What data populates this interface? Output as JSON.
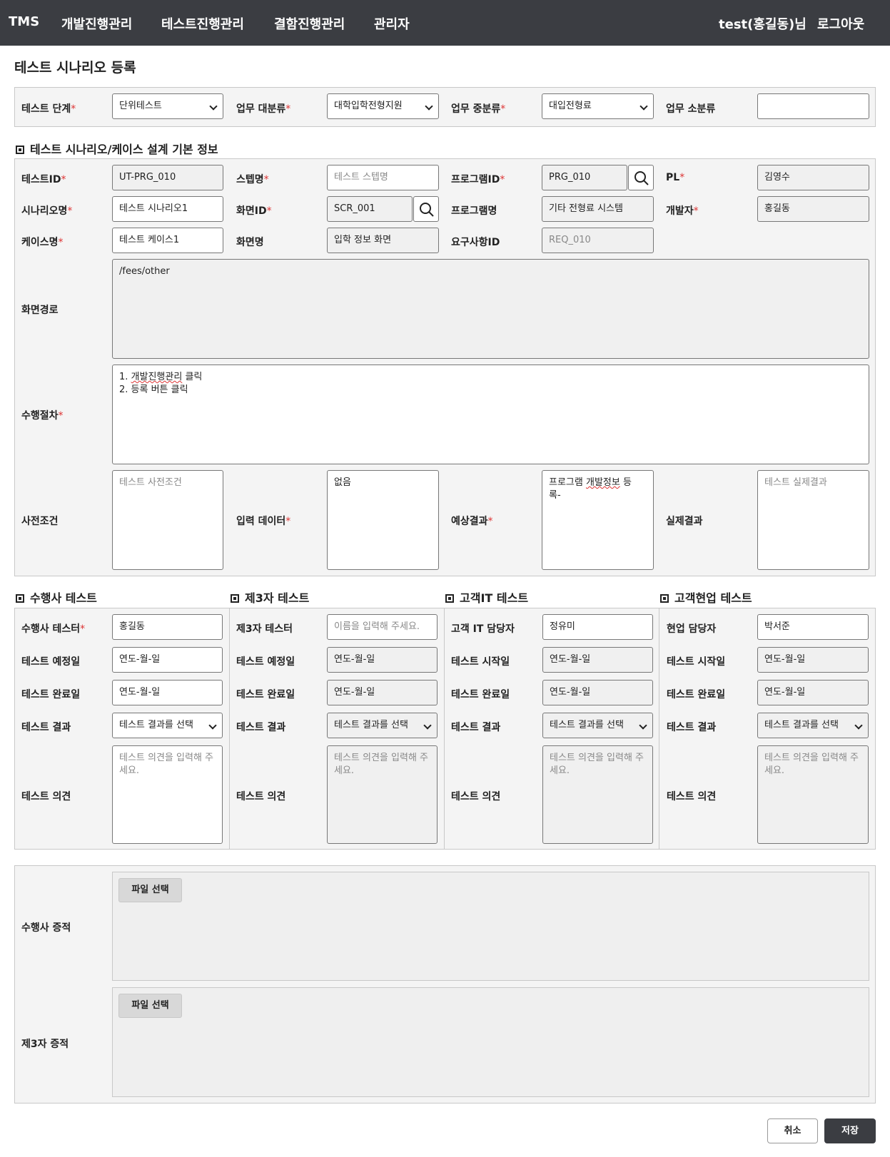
{
  "nav": {
    "brand": "TMS",
    "menu": [
      "개발진행관리",
      "테스트진행관리",
      "결함진행관리",
      "관리자"
    ],
    "user": "test(홍길동)님",
    "logout": "로그아웃"
  },
  "page_title": "테스트 시나리오 등록",
  "filters": {
    "test_stage": {
      "label": "테스트 단계",
      "value": "단위테스트"
    },
    "biz_major": {
      "label": "업무 대분류",
      "value": "대학입학전형지원"
    },
    "biz_middle": {
      "label": "업무 중분류",
      "value": "대입전형료"
    },
    "biz_minor": {
      "label": "업무 소분류",
      "value": ""
    }
  },
  "basic_section_title": "테스트 시나리오/케이스 설계 기본 정보",
  "basic": {
    "test_id": {
      "label": "테스트ID",
      "value": "UT-PRG_010"
    },
    "step_name": {
      "label": "스텝명",
      "placeholder": "테스트 스텝명"
    },
    "program_id": {
      "label": "프로그램ID",
      "value": "PRG_010"
    },
    "pl": {
      "label": "PL",
      "value": "김영수"
    },
    "scenario_name": {
      "label": "시나리오명",
      "value": "테스트 시나리오1"
    },
    "screen_id": {
      "label": "화면ID",
      "value": "SCR_001"
    },
    "program_name": {
      "label": "프로그램명",
      "value": "기타 전형료 시스템"
    },
    "developer": {
      "label": "개발자",
      "value": "홍길동"
    },
    "case_name": {
      "label": "케이스명",
      "value": "테스트 케이스1"
    },
    "screen_name": {
      "label": "화면명",
      "value": "입학 정보 화면"
    },
    "requirement_id": {
      "label": "요구사항ID",
      "placeholder": "REQ_010"
    },
    "screen_path": {
      "label": "화면경로",
      "value": "/fees/other"
    },
    "procedure": {
      "label": "수행절차",
      "line1_prefix": "1. ",
      "line1_word": "개발진행관리",
      "line1_suffix": " 클릭",
      "line2": "2. 등록 버튼 클릭"
    },
    "precondition": {
      "label": "사전조건",
      "placeholder": "테스트 사전조건"
    },
    "input_data": {
      "label": "입력 데이터",
      "value": "없음"
    },
    "expected": {
      "label": "예상결과",
      "line1_prefix": "프로그램 ",
      "line1_word": "개발정보",
      "line1_suffix": " 등",
      "line2": "록-"
    },
    "actual": {
      "label": "실제결과",
      "placeholder": "테스트 실제결과"
    }
  },
  "test_sections": [
    {
      "title": "수행사 테스트",
      "tester_label": "수행사 테스터",
      "tester_value": "홍길동",
      "date1_label": "테스트 예정일",
      "date2_label": "테스트 완료일",
      "result_label": "테스트 결과",
      "opinion_label": "테스트 의견"
    },
    {
      "title": "제3자 테스트",
      "tester_label": "제3자 테스터",
      "tester_placeholder": "이름을 입력해 주세요.",
      "date1_label": "테스트 예정일",
      "date2_label": "테스트 완료일",
      "result_label": "테스트 결과",
      "opinion_label": "테스트 의견"
    },
    {
      "title": "고객IT 테스트",
      "tester_label": "고객 IT 담당자",
      "tester_value": "정유미",
      "date1_label": "테스트 시작일",
      "date2_label": "테스트 완료일",
      "result_label": "테스트 결과",
      "opinion_label": "테스트 의견"
    },
    {
      "title": "고객현업 테스트",
      "tester_label": "현업 담당자",
      "tester_value": "박서준",
      "date1_label": "테스트 시작일",
      "date2_label": "테스트 완료일",
      "result_label": "테스트 결과",
      "opinion_label": "테스트 의견"
    }
  ],
  "common": {
    "date_placeholder": "연도-월-일",
    "result_placeholder": "테스트 결과를 선택",
    "opinion_placeholder": "테스트 의견을 입력해 주세요."
  },
  "evidence": {
    "vendor_label": "수행사 증적",
    "third_label": "제3자 증적",
    "file_button": "파일 선택"
  },
  "actions": {
    "cancel": "취소",
    "save": "저장"
  },
  "colors": {
    "topbar": "#3b3d42",
    "required": "#dd3333",
    "save_button": "#3b3d42"
  }
}
